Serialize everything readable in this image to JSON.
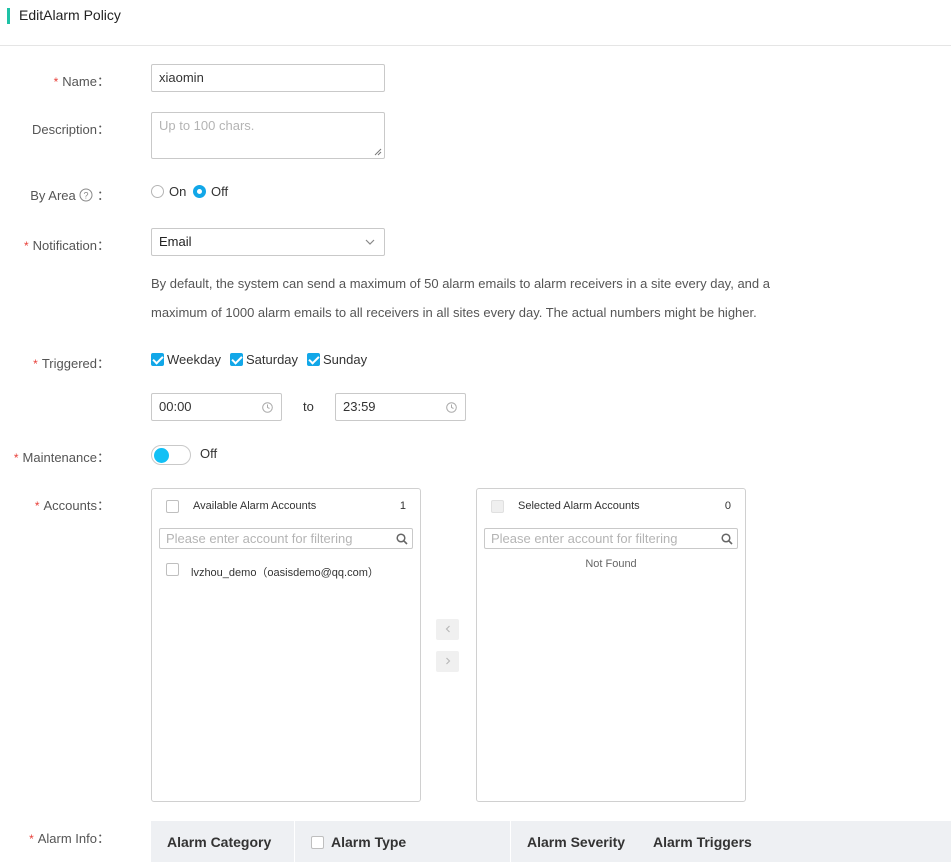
{
  "page": {
    "title": "EditAlarm Policy"
  },
  "form": {
    "name": {
      "label": "Name",
      "value": "xiaomin"
    },
    "description": {
      "label": "Description",
      "placeholder": "Up to 100 chars."
    },
    "by_area": {
      "label": "By Area",
      "options": [
        "On",
        "Off"
      ],
      "selected": "Off"
    },
    "notification": {
      "label": "Notification",
      "value": "Email",
      "note_line1": "By default, the system can send a maximum of 50 alarm emails to alarm receivers in a site every day, and a",
      "note_line2": "maximum of 1000 alarm emails to all receivers in all sites every day. The actual numbers might be higher."
    },
    "triggered": {
      "label": "Triggered",
      "days": [
        {
          "label": "Weekday",
          "checked": true
        },
        {
          "label": "Saturday",
          "checked": true
        },
        {
          "label": "Sunday",
          "checked": true
        }
      ],
      "start_time": "00:00",
      "to_label": "to",
      "end_time": "23:59"
    },
    "maintenance": {
      "label": "Maintenance",
      "state": "Off"
    },
    "accounts": {
      "label": "Accounts",
      "available": {
        "title": "Available Alarm Accounts",
        "count": "1",
        "filter_placeholder": "Please enter account for filtering",
        "items": [
          "lvzhou_demo（oasisdemo@qq.com）"
        ]
      },
      "selected": {
        "title": "Selected Alarm Accounts",
        "count": "0",
        "filter_placeholder": "Please enter account for filtering",
        "empty_text": "Not Found"
      }
    },
    "alarm_info": {
      "label": "Alarm Info",
      "columns": [
        "Alarm Category",
        "Alarm Type",
        "Alarm Severity",
        "Alarm Triggers"
      ]
    }
  },
  "colors": {
    "accent": "#12a7e8",
    "title_accent": "#1ec2a6",
    "required": "#e8403a"
  }
}
